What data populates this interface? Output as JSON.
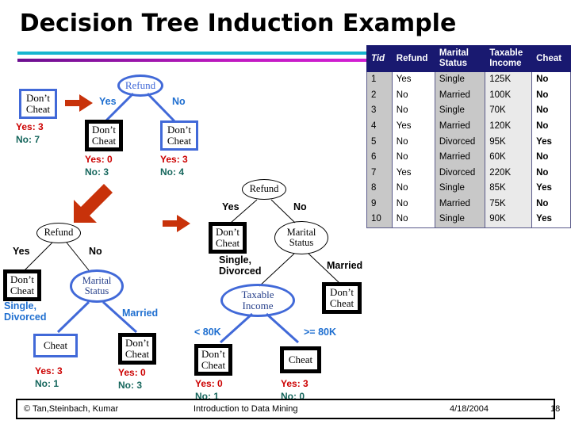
{
  "slide": {
    "title": "Decision Tree Induction Example",
    "accent_cyan": "#16b5cf",
    "accent_magenta": "#a513a5",
    "header_blue": "#191970",
    "node_blue": "#4169d8",
    "arrow_red": "#c8320a",
    "count_yes_color": "#cc0000",
    "count_no_color": "#15665c"
  },
  "table": {
    "headers": [
      "Tid",
      "Refund",
      "Marital Status",
      "Taxable Income",
      "Cheat"
    ],
    "header_lines": {
      "tid": "Tid",
      "refund": "Refund",
      "marital_1": "Marital",
      "marital_2": "Status",
      "income_1": "Taxable",
      "income_2": "Income",
      "cheat": "Cheat"
    },
    "rows": [
      {
        "tid": "1",
        "refund": "Yes",
        "marital": "Single",
        "income": "125K",
        "cheat": "No"
      },
      {
        "tid": "2",
        "refund": "No",
        "marital": "Married",
        "income": "100K",
        "cheat": "No"
      },
      {
        "tid": "3",
        "refund": "No",
        "marital": "Single",
        "income": "70K",
        "cheat": "No"
      },
      {
        "tid": "4",
        "refund": "Yes",
        "marital": "Married",
        "income": "120K",
        "cheat": "No"
      },
      {
        "tid": "5",
        "refund": "No",
        "marital": "Divorced",
        "income": "95K",
        "cheat": "Yes"
      },
      {
        "tid": "6",
        "refund": "No",
        "marital": "Married",
        "income": "60K",
        "cheat": "No"
      },
      {
        "tid": "7",
        "refund": "Yes",
        "marital": "Divorced",
        "income": "220K",
        "cheat": "No"
      },
      {
        "tid": "8",
        "refund": "No",
        "marital": "Single",
        "income": "85K",
        "cheat": "Yes"
      },
      {
        "tid": "9",
        "refund": "No",
        "marital": "Married",
        "income": "75K",
        "cheat": "No"
      },
      {
        "tid": "10",
        "refund": "No",
        "marital": "Single",
        "income": "90K",
        "cheat": "Yes"
      }
    ]
  },
  "step1": {
    "root_box_line1": "Don’t",
    "root_box_line2": "Cheat",
    "root_counts_yes": "Yes: 3",
    "root_counts_no": "No: 7",
    "refund_node": "Refund",
    "edge_yes": "Yes",
    "edge_no": "No",
    "left_box_line1": "Don’t",
    "left_box_line2": "Cheat",
    "left_counts_yes": "Yes: 0",
    "left_counts_no": "No: 3",
    "right_box_line1": "Don’t",
    "right_box_line2": "Cheat",
    "right_counts_yes": "Yes: 3",
    "right_counts_no": "No: 4"
  },
  "step2": {
    "refund_node": "Refund",
    "edge_yes": "Yes",
    "edge_no": "No",
    "dontcheat_line1": "Don’t",
    "dontcheat_line2": "Cheat",
    "marital_node_line1": "Marital",
    "marital_node_line2": "Status",
    "edge_single_line1": "Single,",
    "edge_single_line2": "Divorced",
    "edge_married": "Married",
    "cheat_box": "Cheat",
    "cheat_counts_yes": "Yes: 3",
    "cheat_counts_no": "No: 1",
    "dontcheat_box_line1": "Don’t",
    "dontcheat_box_line2": "Cheat",
    "dontcheat_counts_yes": "Yes: 0",
    "dontcheat_counts_no": "No: 3"
  },
  "step3": {
    "refund_node": "Refund",
    "edge_yes": "Yes",
    "edge_no": "No",
    "dontcheat_line1": "Don’t",
    "dontcheat_line2": "Cheat",
    "marital_node_line1": "Marital",
    "marital_node_line2": "Status",
    "edge_single_line1": "Single,",
    "edge_single_line2": "Divorced",
    "edge_married": "Married",
    "married_box_line1": "Don’t",
    "married_box_line2": "Cheat",
    "income_node_line1": "Taxable",
    "income_node_line2": "Income",
    "edge_lt80": "< 80K",
    "edge_ge80": ">= 80K",
    "lt_box_line1": "Don’t",
    "lt_box_line2": "Cheat",
    "lt_counts_yes": "Yes: 0",
    "lt_counts_no": "No: 1",
    "ge_box": "Cheat",
    "ge_counts_yes": "Yes: 3",
    "ge_counts_no": "No: 0"
  },
  "footer": {
    "author": "© Tan,Steinbach, Kumar",
    "course": "Introduction to Data Mining",
    "date": "4/18/2004",
    "page": "18"
  }
}
